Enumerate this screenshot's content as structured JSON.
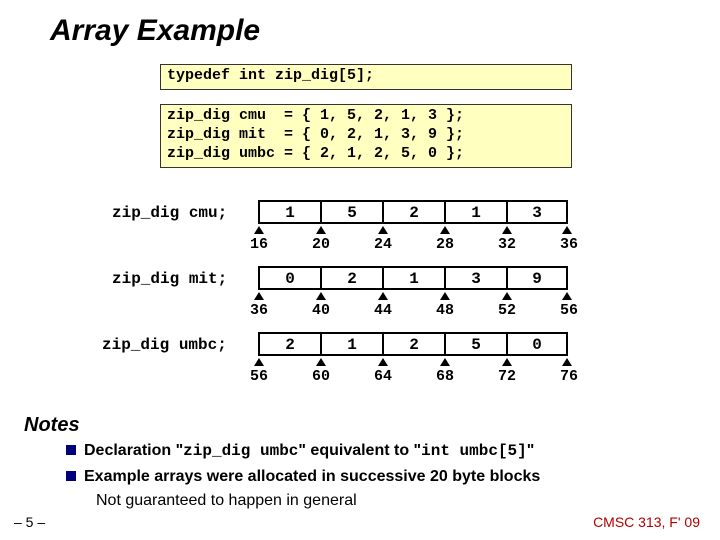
{
  "title": "Array Example",
  "code": {
    "typedef": "typedef int zip_dig[5];",
    "decls": "zip_dig cmu  = { 1, 5, 2, 1, 3 };\nzip_dig mit  = { 0, 2, 1, 3, 9 };\nzip_dig umbc = { 2, 1, 2, 5, 0 };"
  },
  "arrays": {
    "cmu": {
      "label": "zip_dig cmu;",
      "vals": [
        "1",
        "5",
        "2",
        "1",
        "3"
      ],
      "addrs": [
        "16",
        "20",
        "24",
        "28",
        "32",
        "36"
      ]
    },
    "mit": {
      "label": "zip_dig mit;",
      "vals": [
        "0",
        "2",
        "1",
        "3",
        "9"
      ],
      "addrs": [
        "36",
        "40",
        "44",
        "48",
        "52",
        "56"
      ]
    },
    "umbc": {
      "label": "zip_dig umbc;",
      "vals": [
        "2",
        "1",
        "2",
        "5",
        "0"
      ],
      "addrs": [
        "56",
        "60",
        "64",
        "68",
        "72",
        "76"
      ]
    }
  },
  "notes": {
    "heading": "Notes",
    "n1a": "Declaration \"",
    "n1b": "zip_dig umbc",
    "n1c": "\" equivalent to \"",
    "n1d": "int umbc[5]",
    "n1e": "\"",
    "n2": "Example arrays were allocated in successive 20 byte blocks",
    "n2a": "Not guaranteed to happen in general"
  },
  "footer": {
    "page": "– 5 –",
    "course": "CMSC 313, F' 09"
  }
}
